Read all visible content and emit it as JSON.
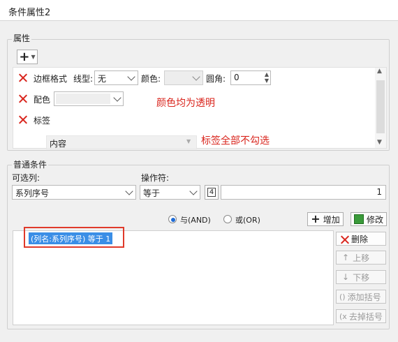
{
  "window": {
    "title": "条件属性2"
  },
  "props": {
    "legend": "属性",
    "add_symbol": "+",
    "row1": {
      "label": "边框格式",
      "linetype_label": "线型:",
      "linetype_value": "无",
      "color_label": "颜色:",
      "radius_label": "圆角:",
      "radius_value": "0"
    },
    "row2": {
      "label": "配色"
    },
    "row3": {
      "label": "标签",
      "content_value": "内容"
    },
    "note_colors": "颜色均为透明",
    "note_labels": "标签全部不勾选"
  },
  "condition": {
    "legend": "普通条件",
    "column_label": "可选列:",
    "column_value": "系列序号",
    "operator_label": "操作符:",
    "operator_value": "等于",
    "value_type_icon": "4",
    "value": "1",
    "and_label": "与(AND)",
    "or_label": "或(OR)",
    "add_label": "增加",
    "modify_label": "修改",
    "list_item": "(列名:系列序号) 等于 1",
    "delete_label": "删除",
    "up_label": "上移",
    "down_label": "下移",
    "add_paren_label": "添加括号",
    "remove_paren_label": "去掉括号"
  },
  "colors": {
    "accent": "#d9251d",
    "selection": "#3a8ee6"
  }
}
